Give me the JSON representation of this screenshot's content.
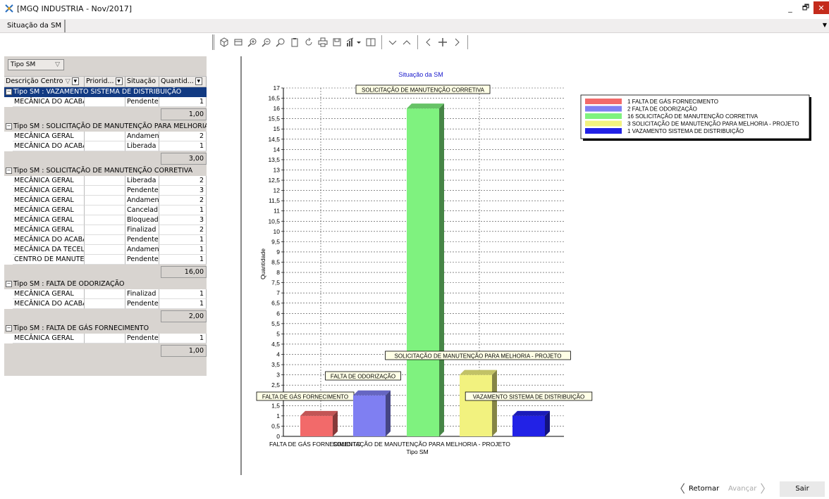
{
  "window": {
    "title": "[MGQ INDUSTRIA - Nov/2017]",
    "minimize": "_",
    "restore": "🗗",
    "close": "✕"
  },
  "tabs": [
    {
      "label": "Situação da SM"
    }
  ],
  "toolbar": {
    "icons": [
      "box-icon",
      "window-icon",
      "zoom-in-icon",
      "zoom-out-icon",
      "zoom-fit-icon",
      "clipboard-icon",
      "rotate-icon",
      "print-icon",
      "save-icon",
      "chart-type-icon",
      "layout-icon",
      "collapse-icon",
      "expand-icon",
      "prev-icon",
      "move-icon",
      "next-icon"
    ]
  },
  "grid": {
    "groupbox_label": "Tipo SM",
    "columns": [
      "Descrição Centro",
      "Priorid...",
      "Situação",
      "Quantid..."
    ],
    "groups": [
      {
        "title": "Tipo SM : VAZAMENTO SISTEMA DE DISTRIBUIÇÃO",
        "selected": true,
        "rows": [
          [
            "MECÂNICA DO ACABAI",
            "",
            "Pendente",
            "1"
          ]
        ],
        "total": "1,00"
      },
      {
        "title": "Tipo SM : SOLICITAÇÃO DE MANUTENÇÃO PARA MELHORIA - I",
        "selected": false,
        "rows": [
          [
            "MECÂNICA GERAL",
            "",
            "Andamen",
            "2"
          ],
          [
            "MECÂNICA DO ACABAI",
            "",
            "Liberada",
            "1"
          ]
        ],
        "total": "3,00"
      },
      {
        "title": "Tipo SM : SOLICITAÇÃO DE MANUTENÇÃO CORRETIVA",
        "selected": false,
        "rows": [
          [
            "MECÂNICA GERAL",
            "",
            "Liberada",
            "2"
          ],
          [
            "MECÂNICA GERAL",
            "",
            "Pendente",
            "3"
          ],
          [
            "MECÂNICA GERAL",
            "",
            "Andamen",
            "2"
          ],
          [
            "MECÂNICA GERAL",
            "",
            "Cancelad",
            "1"
          ],
          [
            "MECÂNICA GERAL",
            "",
            "Bloquead",
            "3"
          ],
          [
            "MECÂNICA GERAL",
            "",
            "Finalizad",
            "2"
          ],
          [
            "MECÂNICA DO ACABAI",
            "",
            "Pendente",
            "1"
          ],
          [
            "MECÂNICA DA TECELA",
            "",
            "Andamen",
            "1"
          ],
          [
            "CENTRO DE MANUTEN",
            "",
            "Pendente",
            "1"
          ]
        ],
        "total": "16,00"
      },
      {
        "title": "Tipo SM : FALTA DE ODORIZAÇÃO",
        "selected": false,
        "rows": [
          [
            "MECÂNICA GERAL",
            "",
            "Finalizad",
            "1"
          ],
          [
            "MECÂNICA DO ACABAI",
            "",
            "Pendente",
            "1"
          ]
        ],
        "total": "2,00"
      },
      {
        "title": "Tipo SM : FALTA DE GÁS FORNECIMENTO",
        "selected": false,
        "rows": [
          [
            "MECÂNICA GERAL",
            "",
            "Pendente",
            "1"
          ]
        ],
        "total": "1,00"
      }
    ]
  },
  "chart_data": {
    "type": "bar",
    "title": "Situação da SM",
    "xlabel": "Tipo SM",
    "ylabel": "Quantidade",
    "ylim": [
      0,
      17
    ],
    "ytick_step": 0.5,
    "categories": [
      "FALTA DE GÁS FORNECIMENTO",
      "FALTA DE ODORIZAÇÃO",
      "SOLICITAÇÃO DE MANUTENÇÃO CORRETIVA",
      "SOLICITAÇÃO DE MANUTENÇÃO PARA MELHORIA - PROJETO",
      "VAZAMENTO SISTEMA DE DISTRIBUIÇÃO"
    ],
    "visible_xtick_labels": [
      "FALTA DE GÁS FORNECIMENTO",
      "",
      "SOLICITAÇÃO DE MANUTENÇÃO PARA MELHORIA - PROJETO",
      "",
      ""
    ],
    "values": [
      1,
      2,
      16,
      3,
      1
    ],
    "colors": [
      "#f26a6a",
      "#7f7ff2",
      "#7ff27f",
      "#f2f27f",
      "#2222e6"
    ],
    "legend": [
      {
        "label": "1 FALTA DE GÁS FORNECIMENTO",
        "color": "#f26a6a"
      },
      {
        "label": "2 FALTA DE ODORIZAÇÃO",
        "color": "#7f7ff2"
      },
      {
        "label": "16 SOLICITAÇÃO DE MANUTENÇÃO CORRETIVA",
        "color": "#7ff27f"
      },
      {
        "label": "3 SOLICITAÇÃO DE MANUTENÇÃO PARA MELHORIA - PROJETO",
        "color": "#f2f27f"
      },
      {
        "label": "1 VAZAMENTO SISTEMA DE DISTRIBUIÇÃO",
        "color": "#2222e6"
      }
    ],
    "legend_position": "top-right",
    "grid": true
  },
  "footer": {
    "back_label": "Retornar",
    "next_label": "Avançar",
    "exit_label": "Sair"
  }
}
